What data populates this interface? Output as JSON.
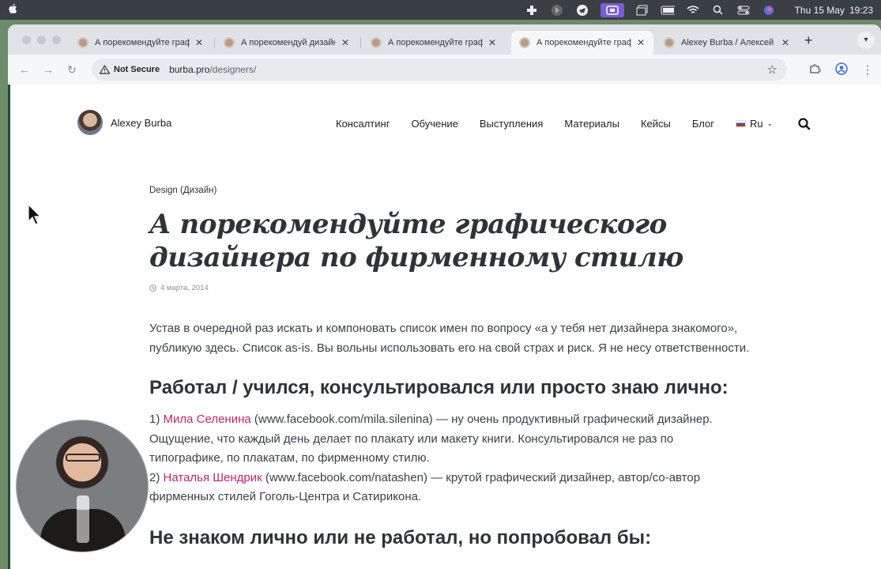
{
  "menubar": {
    "apple": "",
    "date": "Thu 15 May",
    "time": "19:23"
  },
  "tabs": [
    {
      "title": "А порекомендуйте графи"
    },
    {
      "title": "А порекомендуй дизайне"
    },
    {
      "title": "А порекомендуйте граф"
    },
    {
      "title": "А порекомендуйте граф"
    },
    {
      "title": "Alexey Burba / Алексей Б"
    }
  ],
  "toolbar": {
    "security": "Not Secure",
    "url_host": "burba.pro",
    "url_path": "/designers/"
  },
  "site": {
    "brand": "Alexey Burba",
    "nav": [
      "Консалтинг",
      "Обучение",
      "Выступления",
      "Материалы",
      "Кейсы",
      "Блог"
    ],
    "lang": "Ru"
  },
  "article": {
    "category": "Design (Дизайн)",
    "title": "А порекомендуйте графического дизайнера по фирменному стилю",
    "date": "4 марта, 2014",
    "intro": "Устав в очередной раз искать и компоновать список имен по вопросу «а у тебя нет дизайнера знакомого», публикую здесь. Список as-is. Вы вольны использовать его на свой страх и риск. Я не несу ответственности.",
    "h2": "Работал / учился, консультировался или просто знаю лично:",
    "items": [
      {
        "num": "1) ",
        "name": "Мила Селенина",
        "text": " (www.facebook.com/mila.silenina) — ну очень продуктивный графический дизайнер. Ощущение, что каждый день делает по плакату или макету книги. Консультировался не раз по типографике, по плакатам, по фирменному стилю."
      },
      {
        "num": "2) ",
        "name": "Наталья Шендрик",
        "text": " (www.facebook.com/natashen) — крутой графический дизайнер, автор/со-автор фирменных стилей Гоголь-Центра и Сатирикона."
      }
    ],
    "h2b": "Не знаком лично или не работал, но попробовал бы:"
  }
}
